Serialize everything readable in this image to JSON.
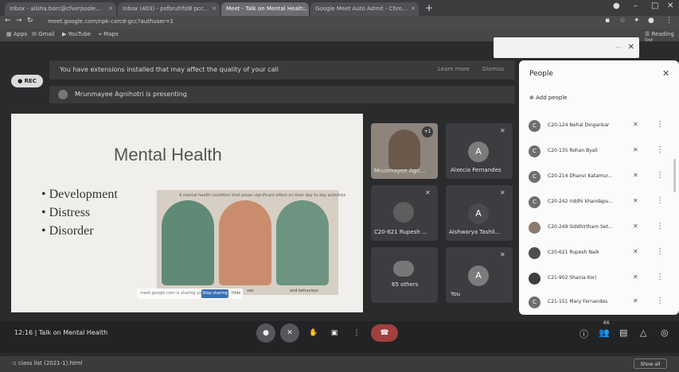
{
  "browser": {
    "tabs": [
      {
        "title": "Inbox - alisha.borc@cfverpoole..."
      },
      {
        "title": "Inbox (403) - psfbrufrfsl8 pcc..."
      },
      {
        "title": "Meet - Talk on Mental Healt..."
      },
      {
        "title": "Google Meet Auto Admit - Chro..."
      }
    ],
    "url": "meet.google.com/npk-cxrcd-gcc?authuser=1",
    "bookmarks": {
      "apps": "Apps",
      "gmail": "Gmail",
      "youtube": "YouTube",
      "maps": "Maps",
      "reading_list": "Reading list"
    }
  },
  "notice": {
    "text": "You have extensions installed that may affect the quality of your call",
    "learn_more": "Learn more",
    "dismiss": "Dismiss"
  },
  "presenting": {
    "text": "Mrunmayee Agnihotri is presenting"
  },
  "rec": {
    "label": "REC"
  },
  "slide": {
    "title": "Mental Health",
    "bullets": [
      "• Development",
      "• Distress",
      "• Disorder"
    ],
    "illustration_caption": "A mental health condition that poses significant effect on their day to day activities",
    "toast_text": "meet.google.com is sharing your screen",
    "toast_button": "Stop sharing",
    "toast_hide": "Hide",
    "cap_left": "ves",
    "cap_right": "and behaviour"
  },
  "tiles": [
    {
      "name": "Mrunmayee Agn...",
      "badge": "+1"
    },
    {
      "name": "Alxecia Fernandes",
      "initial": "A"
    },
    {
      "name": "C20-621 Rupesh ...",
      "initial": ""
    },
    {
      "name": "Aishwarya Tashil...",
      "initial": "A"
    },
    {
      "name": "65 others"
    },
    {
      "name": "You",
      "initial": "A"
    }
  ],
  "bottom": {
    "time": "12:16",
    "meeting": "Talk on Mental Health",
    "people_count": "66"
  },
  "people": {
    "title": "People",
    "add": "Add people",
    "rows": [
      {
        "initial": "C",
        "name": "C20-124 Nehal Dingankar"
      },
      {
        "initial": "C",
        "name": "C20-135 Rohan Byali"
      },
      {
        "initial": "C",
        "name": "C20-214 Dhanvi Katamur..."
      },
      {
        "initial": "C",
        "name": "C20-242 riddhi khandapu..."
      },
      {
        "initial": "",
        "name": "C20-249 Siddhirtham Set..."
      },
      {
        "initial": "",
        "name": "C20-621 Rupesh Naik"
      },
      {
        "initial": "",
        "name": "C21-902 Shania Kori"
      },
      {
        "initial": "C",
        "name": "C21-151 Mary Fernandes"
      }
    ]
  },
  "download": {
    "file": "class list (2021-1).html",
    "show_all": "Show all"
  }
}
